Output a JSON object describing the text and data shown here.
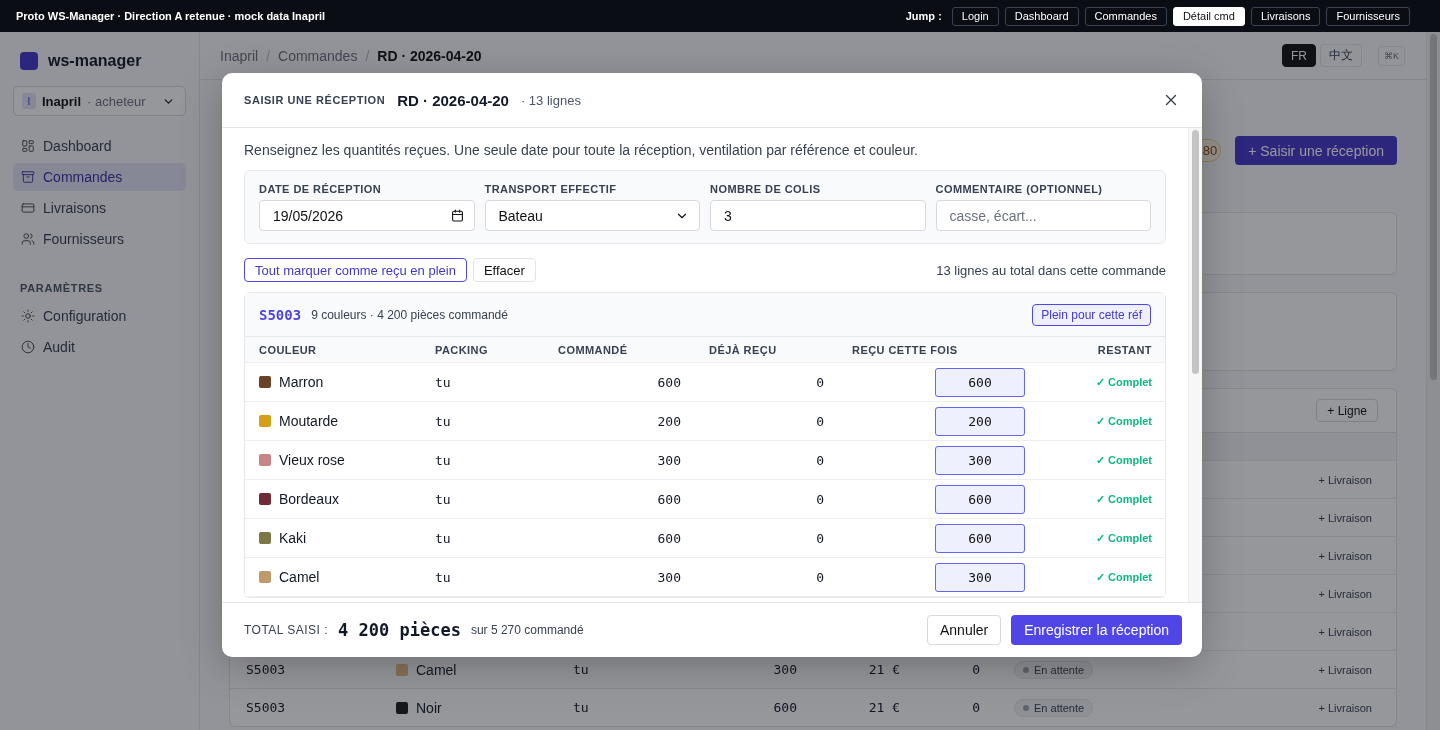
{
  "topbar": {
    "title": "Proto WS-Manager · Direction A retenue · mock data Inapril",
    "jump_label": "Jump :",
    "jump_links": [
      {
        "label": "Login",
        "selected": false
      },
      {
        "label": "Dashboard",
        "selected": false
      },
      {
        "label": "Commandes",
        "selected": false
      },
      {
        "label": "Détail cmd",
        "selected": true
      },
      {
        "label": "Livraisons",
        "selected": false
      },
      {
        "label": "Fournisseurs",
        "selected": false
      }
    ]
  },
  "sidebar": {
    "app_name": "ws-manager",
    "account": {
      "initial": "I",
      "name": "Inapril",
      "role": "· acheteur"
    },
    "nav": [
      {
        "label": "Dashboard",
        "selected": false
      },
      {
        "label": "Commandes",
        "selected": true
      },
      {
        "label": "Livraisons",
        "selected": false
      },
      {
        "label": "Fournisseurs",
        "selected": false
      }
    ],
    "section": "PARAMÈTRES",
    "settings": [
      {
        "label": "Configuration",
        "selected": false
      },
      {
        "label": "Audit",
        "selected": false
      }
    ]
  },
  "header": {
    "breadcrumb": [
      "Inapril",
      "Commandes",
      "RD · 2026-04-20"
    ],
    "separator": "/",
    "languages": [
      {
        "label": "FR",
        "selected": true
      },
      {
        "label": "中文",
        "selected": false
      }
    ],
    "shortcut": "⌘K"
  },
  "page": {
    "badge": "80",
    "primary_action": "+ Saisir une réception",
    "add_line": "+ Ligne",
    "rows": [
      {
        "action": "+ Livraison"
      },
      {
        "action": "+ Livraison"
      },
      {
        "action": "+ Livraison"
      },
      {
        "action": "+ Livraison"
      },
      {
        "action": "+ Livraison"
      },
      {
        "ref": "S5003",
        "color_name": "Camel",
        "color": "#8a7358",
        "packing": "tu",
        "qty": "300",
        "price": "21 €",
        "received": "0",
        "status": "En attente",
        "action": "+ Livraison"
      },
      {
        "ref": "S5003",
        "color_name": "Noir",
        "color": "#18191e",
        "packing": "tu",
        "qty": "600",
        "price": "21 €",
        "received": "0",
        "status": "En attente",
        "action": "+ Livraison"
      }
    ]
  },
  "modal": {
    "kicker": "SAISIR UNE RÉCEPTION",
    "title": "RD · 2026-04-20",
    "subtitle": "· 13 lignes",
    "intro": "Renseignez les quantités reçues. Une seule date pour toute la réception, ventilation par référence et couleur.",
    "fields": [
      {
        "kind": "date",
        "label": "DATE DE RÉCEPTION",
        "value": "19/05/2026"
      },
      {
        "kind": "select",
        "label": "TRANSPORT EFFECTIF",
        "value": "Bateau"
      },
      {
        "kind": "text",
        "label": "NOMBRE DE COLIS",
        "value": "3"
      },
      {
        "kind": "text",
        "label": "COMMENTAIRE (OPTIONNEL)",
        "placeholder": "casse, écart..."
      }
    ],
    "fill_all": "Tout marquer comme reçu en plein",
    "clear": "Effacer",
    "line_count": "13 lignes au total dans cette commande",
    "group": {
      "ref": "S5003",
      "summary": "9 couleurs · 4 200 pièces commandé",
      "fill_ref": "Plein pour cette réf",
      "columns": [
        "COULEUR",
        "PACKING",
        "COMMANDÉ",
        "DÉJÀ REÇU",
        "REÇU CETTE FOIS",
        "RESTANT"
      ],
      "rows": [
        {
          "name": "Marron",
          "color": "#6b4226",
          "packing": "tu",
          "ordered": "600",
          "already": "0",
          "received": "600",
          "remaining": "✓ Complet"
        },
        {
          "name": "Moutarde",
          "color": "#d4a017",
          "packing": "tu",
          "ordered": "200",
          "already": "0",
          "received": "200",
          "remaining": "✓ Complet"
        },
        {
          "name": "Vieux rose",
          "color": "#c98585",
          "packing": "tu",
          "ordered": "300",
          "already": "0",
          "received": "300",
          "remaining": "✓ Complet"
        },
        {
          "name": "Bordeaux",
          "color": "#722a36",
          "packing": "tu",
          "ordered": "600",
          "already": "0",
          "received": "600",
          "remaining": "✓ Complet"
        },
        {
          "name": "Kaki",
          "color": "#7b7845",
          "packing": "tu",
          "ordered": "600",
          "already": "0",
          "received": "600",
          "remaining": "✓ Complet"
        },
        {
          "name": "Camel",
          "color": "#c19a6b",
          "packing": "tu",
          "ordered": "300",
          "already": "0",
          "received": "300",
          "remaining": "✓ Complet"
        }
      ]
    },
    "footer": {
      "total_label": "TOTAL SAISI :",
      "total": "4 200 pièces",
      "of": "sur 5 270 commandé",
      "cancel": "Annuler",
      "submit": "Enregistrer la réception"
    }
  }
}
